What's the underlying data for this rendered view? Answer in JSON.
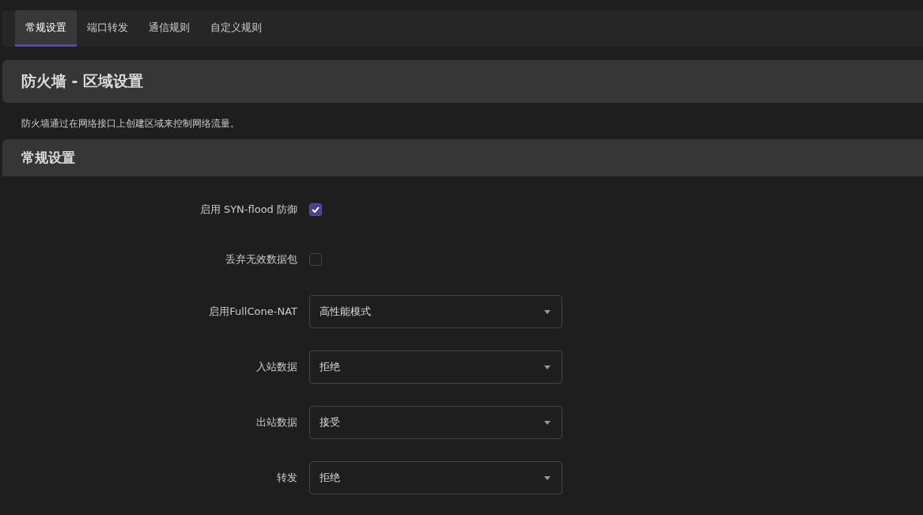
{
  "tabs": [
    {
      "label": "常规设置",
      "selected": true
    },
    {
      "label": "端口转发",
      "selected": false
    },
    {
      "label": "通信规则",
      "selected": false
    },
    {
      "label": "自定义规则",
      "selected": false
    }
  ],
  "page_title": "防火墙 - 区域设置",
  "description": "防火墙通过在网络接口上创建区域来控制网络流量。",
  "section": {
    "title": "常规设置",
    "fields": [
      {
        "kind": "checkbox",
        "label": "启用 SYN-flood 防御",
        "checked": true
      },
      {
        "kind": "checkbox",
        "label": "丢弃无效数据包",
        "checked": false
      },
      {
        "kind": "select",
        "label": "启用FullCone-NAT",
        "value": "高性能模式"
      },
      {
        "kind": "select",
        "label": "入站数据",
        "value": "拒绝"
      },
      {
        "kind": "select",
        "label": "出站数据",
        "value": "接受"
      },
      {
        "kind": "select",
        "label": "转发",
        "value": "拒绝"
      }
    ]
  }
}
